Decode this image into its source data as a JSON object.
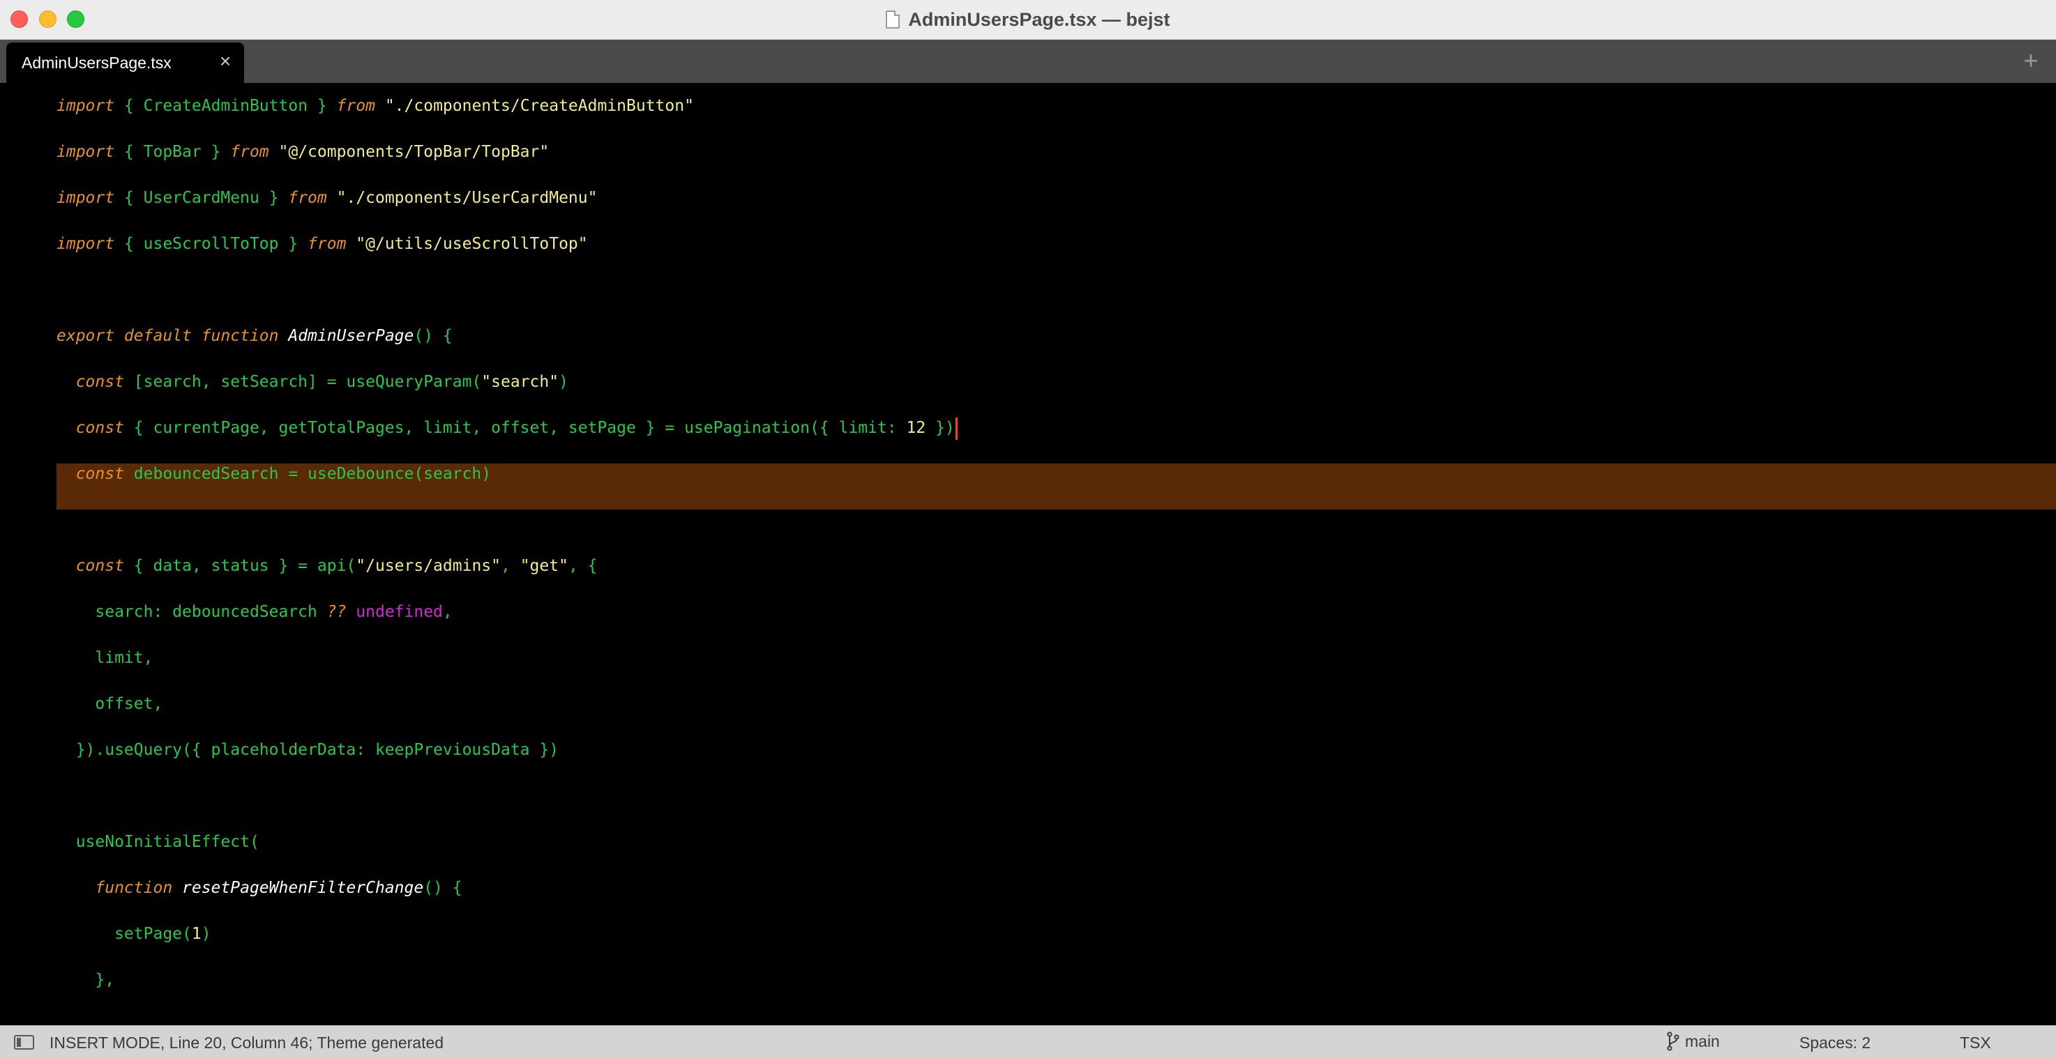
{
  "window": {
    "title": "AdminUsersPage.tsx — bejst"
  },
  "tabs": [
    {
      "label": "AdminUsersPage.tsx",
      "close_glyph": "×",
      "active": true
    }
  ],
  "new_tab_glyph": "+",
  "editor": {
    "highlighted_line_index": 7,
    "lines": [
      [
        [
          "kw",
          "import"
        ],
        [
          "id",
          " { CreateAdminButton } "
        ],
        [
          "kw",
          "from"
        ],
        [
          "str",
          " \"./components/CreateAdminButton\""
        ]
      ],
      [
        [
          "kw",
          "import"
        ],
        [
          "id",
          " { TopBar } "
        ],
        [
          "kw",
          "from"
        ],
        [
          "str",
          " \"@/components/TopBar/TopBar\""
        ]
      ],
      [
        [
          "kw",
          "import"
        ],
        [
          "id",
          " { UserCardMenu } "
        ],
        [
          "kw",
          "from"
        ],
        [
          "str",
          " \"./components/UserCardMenu\""
        ]
      ],
      [
        [
          "kw",
          "import"
        ],
        [
          "id",
          " { useScrollToTop } "
        ],
        [
          "kw",
          "from"
        ],
        [
          "str",
          " \"@/utils/useScrollToTop\""
        ]
      ],
      [],
      [
        [
          "kw",
          "export default function "
        ],
        [
          "fn",
          "AdminUserPage"
        ],
        [
          "id",
          "() {"
        ]
      ],
      [
        [
          "kw",
          "  const "
        ],
        [
          "id",
          "[search, setSearch] = useQueryParam("
        ],
        [
          "str",
          "\"search\""
        ],
        [
          "id",
          ")"
        ]
      ],
      [
        [
          "kw",
          "  const "
        ],
        [
          "id",
          "{ currentPage, getTotalPages, limit, offset, setPage } = usePagination({ limit: "
        ],
        [
          "num",
          "12"
        ],
        [
          "id",
          " })"
        ]
      ],
      [
        [
          "kw",
          "  const "
        ],
        [
          "id",
          "debouncedSearch = useDebounce(search)"
        ]
      ],
      [],
      [
        [
          "kw",
          "  const "
        ],
        [
          "id",
          "{ data, status } = api("
        ],
        [
          "str",
          "\"/users/admins\""
        ],
        [
          "id",
          ", "
        ],
        [
          "str",
          "\"get\""
        ],
        [
          "id",
          ", {"
        ]
      ],
      [
        [
          "id",
          "    search: debouncedSearch "
        ],
        [
          "op",
          "??"
        ],
        [
          "und",
          " undefined"
        ],
        [
          "id",
          ","
        ]
      ],
      [
        [
          "id",
          "    limit,"
        ]
      ],
      [
        [
          "id",
          "    offset,"
        ]
      ],
      [
        [
          "id",
          "  }).useQuery({ placeholderData: keepPreviousData })"
        ]
      ],
      [],
      [
        [
          "id",
          "  useNoInitialEffect("
        ]
      ],
      [
        [
          "kw",
          "    function "
        ],
        [
          "fn",
          "resetPageWhenFilterChange"
        ],
        [
          "id",
          "() {"
        ]
      ],
      [
        [
          "id",
          "      setPage("
        ],
        [
          "num",
          "1"
        ],
        [
          "id",
          ")"
        ]
      ],
      [
        [
          "id",
          "    },"
        ]
      ]
    ]
  },
  "status_bar": {
    "mode_text": "INSERT MODE, Line 20, Column 46; Theme generated",
    "branch": "main",
    "indentation": "Spaces: 2",
    "syntax": "TSX"
  },
  "icons": {
    "file": "document-icon",
    "branch": "git-branch-icon",
    "sidebar": "sidebar-toggle-icon"
  },
  "colors": {
    "keyword": "#e8912d",
    "identifier": "#29c74a",
    "string": "#f3ec8e",
    "function_name": "#ffffff",
    "undefined": "#d02bd0",
    "line_highlight": "#5a2a06",
    "cursor": "#ff3b1f"
  }
}
